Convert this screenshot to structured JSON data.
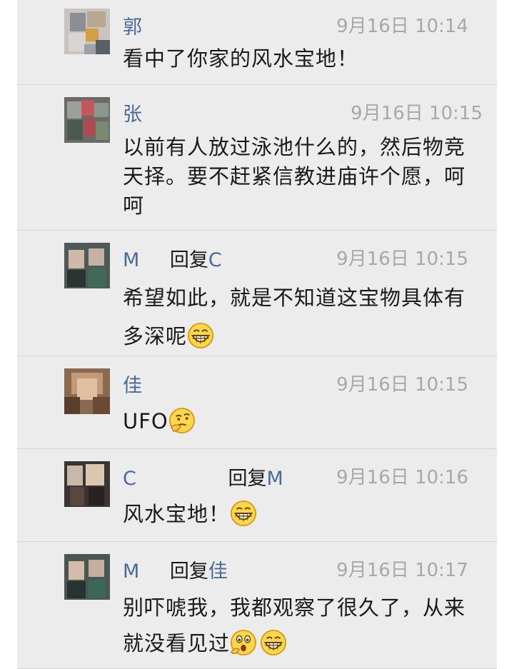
{
  "comments": [
    {
      "name": "郭",
      "reply_label": "",
      "reply_to": "",
      "time": "9月16日 10:14",
      "text": "看中了你家的风水宝地！",
      "emojis": []
    },
    {
      "name": "张",
      "reply_label": "",
      "reply_to": "",
      "time": "9月16日 10:15",
      "text": "以前有人放过泳池什么的，然后物竞天择。要不赶紧信教进庙许个愿，呵呵",
      "emojis": []
    },
    {
      "name": "M",
      "reply_label": "回复",
      "reply_to": "C",
      "time": "9月16日 10:15",
      "text": "希望如此，就是不知道这宝物具体有多深呢",
      "emojis": [
        "grin-emoji"
      ]
    },
    {
      "name": "佳",
      "reply_label": "",
      "reply_to": "",
      "time": "9月16日 10:15",
      "text": "UFO",
      "emojis": [
        "thinking-emoji"
      ]
    },
    {
      "name": "C",
      "reply_label": "回复",
      "reply_to": "M",
      "time": "9月16日 10:16",
      "text": "风水宝地！",
      "emojis": [
        "grin-emoji"
      ]
    },
    {
      "name": "M",
      "reply_label": "回复",
      "reply_to": "佳",
      "time": "9月16日 10:17",
      "text": "别吓唬我，我都观察了很久了，从来就没看见过",
      "emojis": [
        "surprised-emoji",
        "grin-emoji"
      ]
    }
  ],
  "colors": {
    "background": "#ececec",
    "name": "#4a6a98",
    "time": "#a8a8a8",
    "text": "#1a1a1a",
    "divider": "#d6d6d6"
  }
}
